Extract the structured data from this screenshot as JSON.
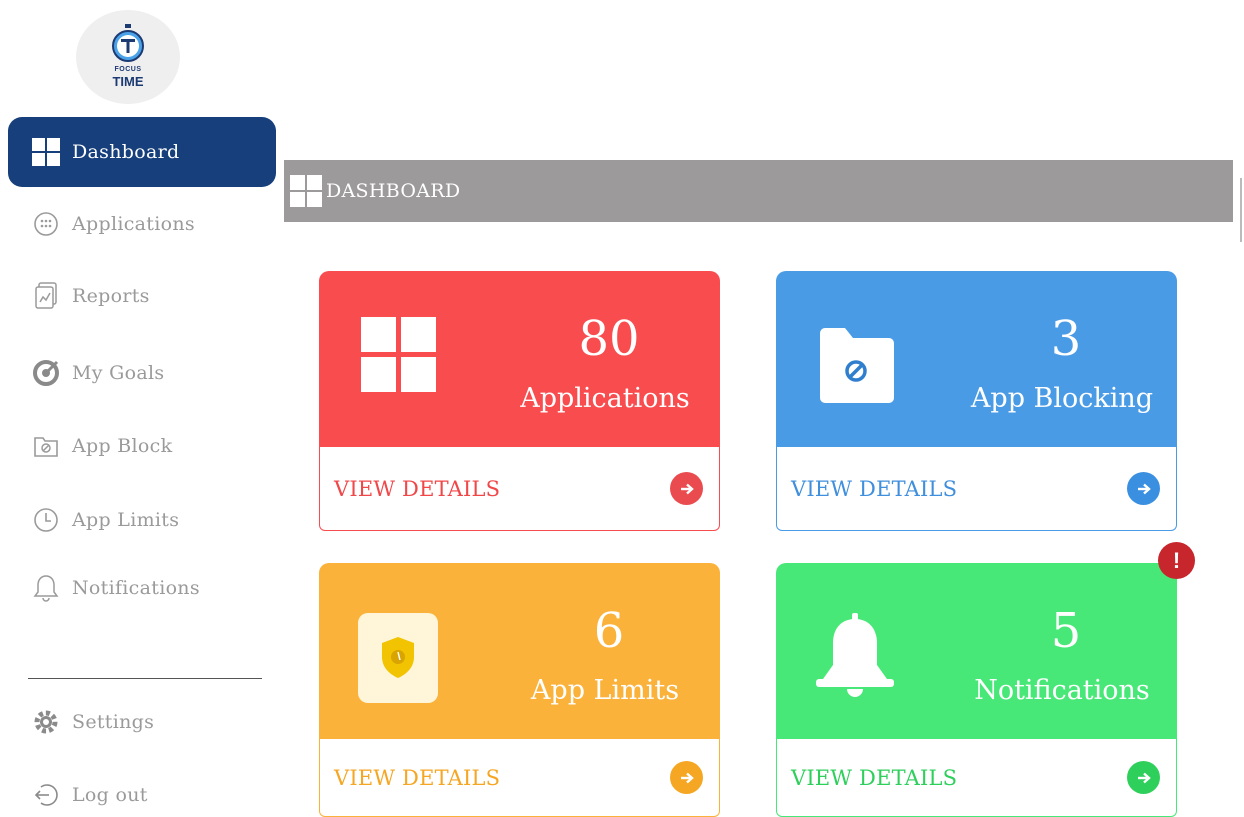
{
  "logo": {
    "line1": "FOCUS",
    "line2": "TIME"
  },
  "sidebar": {
    "items": [
      {
        "label": "Dashboard",
        "icon": "grid-icon",
        "active": true
      },
      {
        "label": "Applications",
        "icon": "apps-icon"
      },
      {
        "label": "Reports",
        "icon": "report-icon"
      },
      {
        "label": "My Goals",
        "icon": "target-icon"
      },
      {
        "label": "App Block",
        "icon": "block-icon"
      },
      {
        "label": "App Limits",
        "icon": "clock-icon"
      },
      {
        "label": "Notifications",
        "icon": "bell-icon"
      }
    ],
    "bottom": [
      {
        "label": "Settings",
        "icon": "gear-icon"
      },
      {
        "label": "Log out",
        "icon": "logout-icon"
      }
    ]
  },
  "header": {
    "title": "DASHBOARD"
  },
  "cards": [
    {
      "count": "80",
      "label": "Applications",
      "action": "VIEW DETAILS",
      "color": "#f84c4f"
    },
    {
      "count": "3",
      "label": "App Blocking",
      "action": "VIEW DETAILS",
      "color": "#4a9be6"
    },
    {
      "count": "6",
      "label": "App Limits",
      "action": "VIEW DETAILS",
      "color": "#fab23a"
    },
    {
      "count": "5",
      "label": "Notifications",
      "action": "VIEW DETAILS",
      "color": "#48e878"
    }
  ],
  "alert": {
    "symbol": "!"
  }
}
